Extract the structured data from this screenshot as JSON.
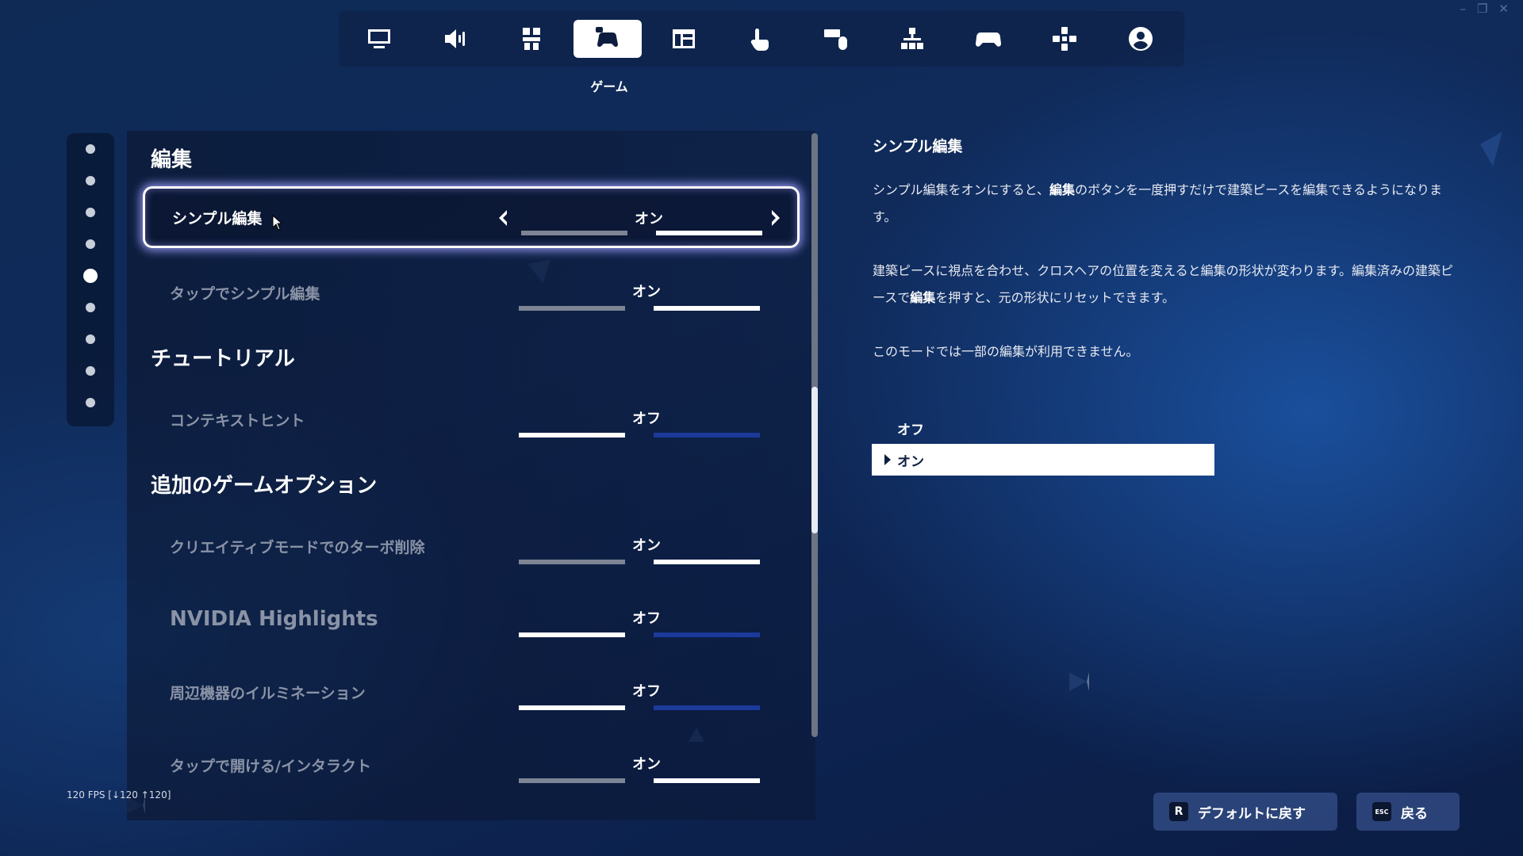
{
  "window_controls": [
    "–",
    "❐",
    "✕"
  ],
  "nav": {
    "active_label": "ゲーム",
    "tabs": [
      {
        "icon": "monitor-icon",
        "active": false
      },
      {
        "icon": "speaker-icon",
        "active": false
      },
      {
        "icon": "accessibility-icon",
        "active": false
      },
      {
        "icon": "gamepad-hand-icon",
        "active": true
      },
      {
        "icon": "window-layout-icon",
        "active": false
      },
      {
        "icon": "touch-icon",
        "active": false
      },
      {
        "icon": "keyboard-mouse-icon",
        "active": false
      },
      {
        "icon": "controller-layout-icon",
        "active": false
      },
      {
        "icon": "controller-icon",
        "active": false
      },
      {
        "icon": "dpad-icon",
        "active": false
      },
      {
        "icon": "account-icon",
        "active": false
      }
    ]
  },
  "rail": {
    "count": 9,
    "active_index": 4
  },
  "sections": {
    "edit": "編集",
    "tutorial": "チュートリアル",
    "extra": "追加のゲームオプション"
  },
  "settings": [
    {
      "label": "シンプル編集",
      "value": "オン"
    },
    {
      "label": "タップでシンプル編集",
      "value": "オン"
    },
    {
      "label": "コンテキストヒント",
      "value": "オフ"
    },
    {
      "label": "クリエイティブモードでのターボ削除",
      "value": "オン"
    },
    {
      "label": "NVIDIA Highlights",
      "value": "オフ"
    },
    {
      "label": "周辺機器のイルミネーション",
      "value": "オフ"
    },
    {
      "label": "タップで開ける/インタラクト",
      "value": "オン"
    }
  ],
  "description": {
    "title": "シンプル編集",
    "p1_a": "シンプル編集をオンにすると、",
    "p1_b": "編集",
    "p1_c": "のボタンを一度押すだけで建築ピースを編集できるようになります。",
    "p2_a": "建築ピースに視点を合わせ、クロスヘアの位置を変えると編集の形状が変わります。編集済みの建築ピースで",
    "p2_b": "編集",
    "p2_c": "を押すと、元の形状にリセットできます。",
    "p3": "このモードでは一部の編集が利用できません。",
    "options": [
      "オフ",
      "オン"
    ],
    "selected_option": "オン"
  },
  "fps": "120 FPS [↓120 ↑120]",
  "buttons": {
    "default_key": "R",
    "default_label": "デフォルトに戻す",
    "back_key": "ESC",
    "back_label": "戻る"
  },
  "colors": {
    "accent_blue": "#1b3a9a",
    "off_grey": "#7d8594"
  }
}
